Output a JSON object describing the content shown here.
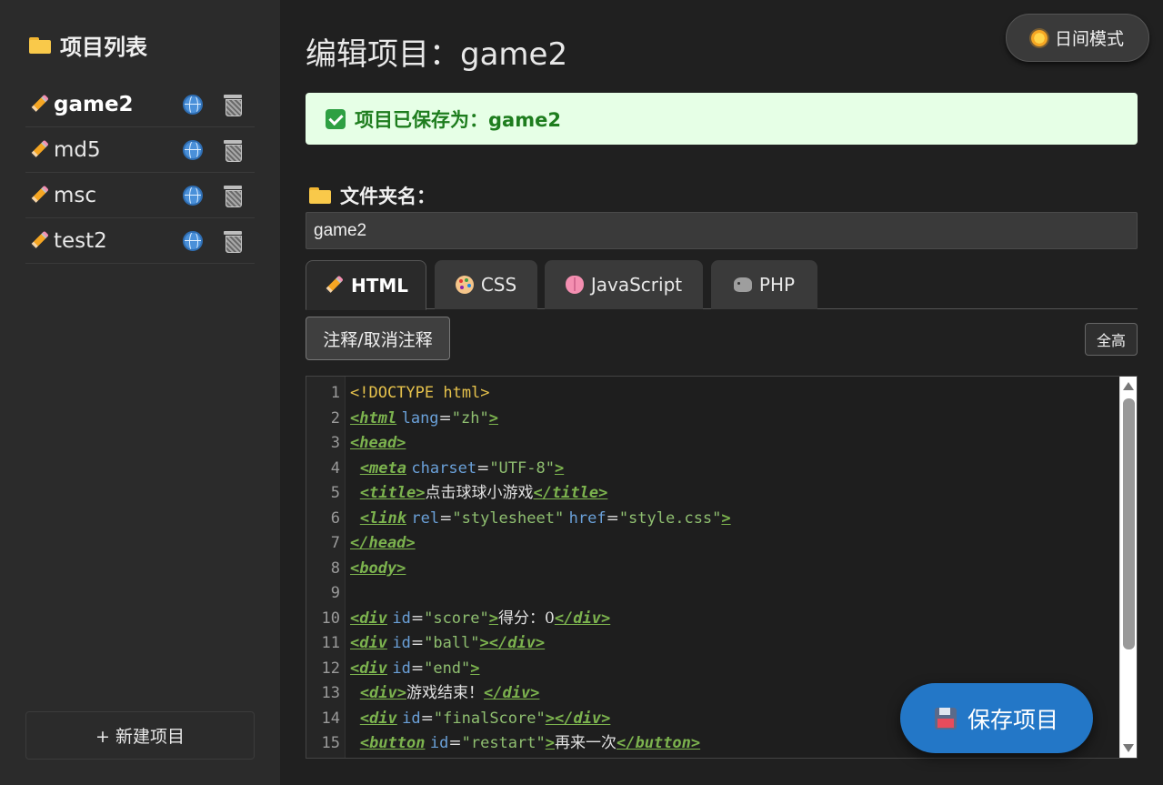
{
  "sidebar": {
    "title": "项目列表",
    "projects": [
      {
        "name": "game2",
        "active": true
      },
      {
        "name": "md5",
        "active": false
      },
      {
        "name": "msc",
        "active": false
      },
      {
        "name": "test2",
        "active": false
      }
    ],
    "new_project_label": "+ 新建项目"
  },
  "header": {
    "title": "编辑项目：game2",
    "theme_toggle_label": "日间模式"
  },
  "alert": {
    "message": "项目已保存为：game2",
    "color": "#1e7d1e"
  },
  "folder": {
    "label": "文件夹名：",
    "value": "game2"
  },
  "tabs": [
    {
      "label": "HTML",
      "icon": "pencil-icon",
      "active": true
    },
    {
      "label": "CSS",
      "icon": "palette-icon",
      "active": false
    },
    {
      "label": "JavaScript",
      "icon": "brain-icon",
      "active": false
    },
    {
      "label": "PHP",
      "icon": "elephant-icon",
      "active": false
    }
  ],
  "toolbar": {
    "comment_label": "注释/取消注释",
    "fullheight_label": "全高"
  },
  "editor": {
    "lines": [
      {
        "no": "1",
        "tokens": [
          [
            "doc",
            "<!DOCTYPE html>"
          ]
        ]
      },
      {
        "no": "2",
        "tokens": [
          [
            "tag",
            "<html"
          ],
          [
            "txt",
            " "
          ],
          [
            "attr",
            "lang"
          ],
          [
            "txt",
            "="
          ],
          [
            "str",
            "\"zh\""
          ],
          [
            "tag",
            ">"
          ]
        ]
      },
      {
        "no": "3",
        "tokens": [
          [
            "tag",
            "<head>"
          ]
        ]
      },
      {
        "no": "4",
        "tokens": [
          [
            "txt",
            "  "
          ],
          [
            "tag",
            "<meta"
          ],
          [
            "txt",
            " "
          ],
          [
            "attr",
            "charset"
          ],
          [
            "txt",
            "="
          ],
          [
            "str",
            "\"UTF-8\""
          ],
          [
            "tag",
            ">"
          ]
        ]
      },
      {
        "no": "5",
        "tokens": [
          [
            "txt",
            "  "
          ],
          [
            "tag",
            "<title>"
          ],
          [
            "txt",
            "点击球球小游戏"
          ],
          [
            "tag",
            "</title>"
          ]
        ]
      },
      {
        "no": "6",
        "tokens": [
          [
            "txt",
            "  "
          ],
          [
            "tag",
            "<link"
          ],
          [
            "txt",
            " "
          ],
          [
            "attr",
            "rel"
          ],
          [
            "txt",
            "="
          ],
          [
            "str",
            "\"stylesheet\""
          ],
          [
            "txt",
            " "
          ],
          [
            "attr",
            "href"
          ],
          [
            "txt",
            "="
          ],
          [
            "str",
            "\"style.css\""
          ],
          [
            "tag",
            ">"
          ]
        ]
      },
      {
        "no": "7",
        "tokens": [
          [
            "tag",
            "</head>"
          ]
        ]
      },
      {
        "no": "8",
        "tokens": [
          [
            "tag",
            "<body>"
          ]
        ]
      },
      {
        "no": "9",
        "tokens": []
      },
      {
        "no": "10",
        "tokens": [
          [
            "tag",
            "<div"
          ],
          [
            "txt",
            " "
          ],
          [
            "attr",
            "id"
          ],
          [
            "txt",
            "="
          ],
          [
            "str",
            "\"score\""
          ],
          [
            "tag",
            ">"
          ],
          [
            "txt",
            "得分：0"
          ],
          [
            "tag",
            "</div>"
          ]
        ]
      },
      {
        "no": "11",
        "tokens": [
          [
            "tag",
            "<div"
          ],
          [
            "txt",
            " "
          ],
          [
            "attr",
            "id"
          ],
          [
            "txt",
            "="
          ],
          [
            "str",
            "\"ball\""
          ],
          [
            "tag",
            "></div>"
          ]
        ]
      },
      {
        "no": "12",
        "tokens": [
          [
            "tag",
            "<div"
          ],
          [
            "txt",
            " "
          ],
          [
            "attr",
            "id"
          ],
          [
            "txt",
            "="
          ],
          [
            "str",
            "\"end\""
          ],
          [
            "tag",
            ">"
          ]
        ]
      },
      {
        "no": "13",
        "tokens": [
          [
            "txt",
            "  "
          ],
          [
            "tag",
            "<div>"
          ],
          [
            "txt",
            "游戏结束！"
          ],
          [
            "tag",
            "</div>"
          ]
        ]
      },
      {
        "no": "14",
        "tokens": [
          [
            "txt",
            "  "
          ],
          [
            "tag",
            "<div"
          ],
          [
            "txt",
            " "
          ],
          [
            "attr",
            "id"
          ],
          [
            "txt",
            "="
          ],
          [
            "str",
            "\"finalScore\""
          ],
          [
            "tag",
            "></div>"
          ]
        ]
      },
      {
        "no": "15",
        "tokens": [
          [
            "txt",
            "  "
          ],
          [
            "tag",
            "<button"
          ],
          [
            "txt",
            " "
          ],
          [
            "attr",
            "id"
          ],
          [
            "txt",
            "="
          ],
          [
            "str",
            "\"restart\""
          ],
          [
            "tag",
            ">"
          ],
          [
            "txt",
            "再来一次"
          ],
          [
            "tag",
            "</button>"
          ]
        ]
      }
    ]
  },
  "save_button": {
    "label": "保存项目",
    "color": "#2377c7"
  }
}
